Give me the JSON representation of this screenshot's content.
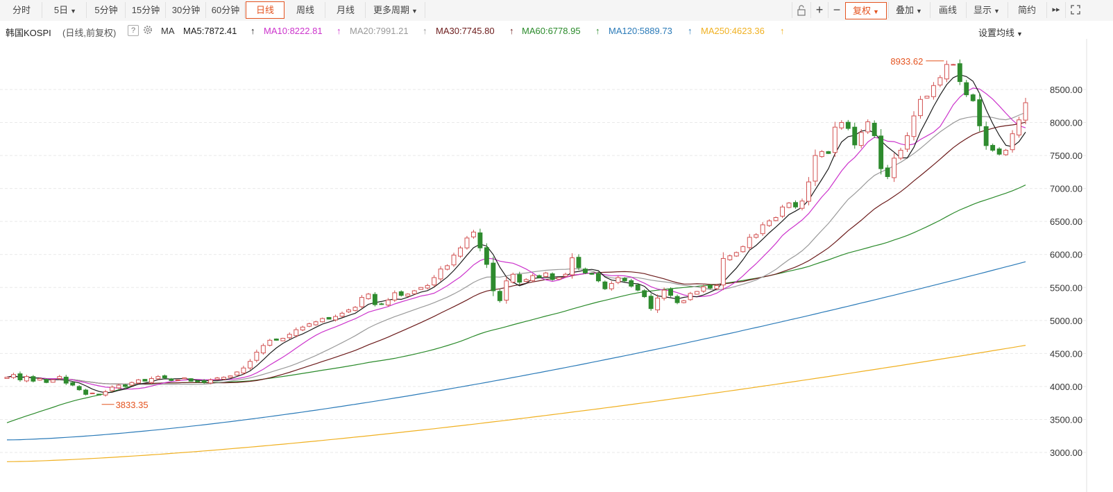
{
  "toolbar": {
    "left_tabs": [
      "分时",
      "5日",
      "5分钟",
      "15分钟",
      "30分钟",
      "60分钟",
      "日线",
      "周线",
      "月线",
      "更多周期"
    ],
    "active_tab": "日线",
    "right_tools": {
      "add": "+",
      "minus": "−",
      "fuquan": "复权",
      "overlay": "叠加",
      "draw": "画线",
      "display": "显示",
      "simple": "简约",
      "next": "▸▸"
    }
  },
  "legend": {
    "title": "韩国KOSPI",
    "subtitle": "(日线,前复权)",
    "help": "?",
    "ma_label": "MA",
    "ma5": "MA5:7872.41",
    "ma10": "MA10:8222.81",
    "ma20": "MA20:7991.21",
    "ma30": "MA30:7745.80",
    "ma60": "MA60:6778.95",
    "ma120": "MA120:5889.73",
    "ma250": "MA250:4623.36",
    "arrow": "↑",
    "settings": "设置均线"
  },
  "colors": {
    "up": "#d25050",
    "down": "#2e8b2e",
    "ma5": "#1a1a1a",
    "ma10": "#cc33cc",
    "ma20": "#999999",
    "ma30": "#6b1a1a",
    "ma60": "#2a8a2a",
    "ma120": "#2a7ab8",
    "ma250": "#f0b020",
    "accent": "#e4531f"
  },
  "chart_data": {
    "type": "candlestick",
    "title": "韩国KOSPI",
    "y_ticks": [
      "8500.00",
      "8000.00",
      "7500.00",
      "7000.00",
      "6500.00",
      "6000.00",
      "5500.00",
      "5000.00",
      "4500.00",
      "4000.00",
      "3500.00",
      "3000.00"
    ],
    "ylim": [
      2750,
      9200
    ],
    "grid": true,
    "annotations": {
      "max_label": "8933.62",
      "min_label": "3833.35",
      "max_value": 8933.62,
      "min_value": 3833.35
    },
    "closes": [
      4140,
      4180,
      4100,
      4150,
      4080,
      4120,
      4060,
      4100,
      4150,
      4050,
      4020,
      3950,
      3880,
      3900,
      3870,
      3920,
      3990,
      4020,
      4000,
      4060,
      4100,
      4080,
      4120,
      4150,
      4130,
      4090,
      4100,
      4130,
      4080,
      4070,
      4060,
      4100,
      4130,
      4140,
      4160,
      4220,
      4280,
      4380,
      4520,
      4620,
      4700,
      4700,
      4730,
      4790,
      4860,
      4900,
      4950,
      4980,
      5030,
      5020,
      5060,
      5110,
      5160,
      5200,
      5350,
      5400,
      5240,
      5250,
      5310,
      5420,
      5380,
      5400,
      5450,
      5500,
      5530,
      5650,
      5780,
      5830,
      5990,
      6100,
      6250,
      6340,
      6100,
      5850,
      5450,
      5300,
      5600,
      5700,
      5580,
      5620,
      5680,
      5650,
      5720,
      5620,
      5650,
      5700,
      5950,
      5800,
      5720,
      5700,
      5600,
      5480,
      5560,
      5650,
      5600,
      5520,
      5460,
      5360,
      5180,
      5340,
      5460,
      5380,
      5270,
      5300,
      5410,
      5440,
      5510,
      5490,
      5530,
      5940,
      5980,
      6030,
      6120,
      6260,
      6300,
      6450,
      6510,
      6560,
      6720,
      6780,
      6720,
      6810,
      7100,
      7500,
      7560,
      7530,
      7930,
      8000,
      7910,
      7660,
      7850,
      8010,
      7800,
      7300,
      7180,
      7460,
      7580,
      7800,
      8100,
      8350,
      8400,
      8560,
      8680,
      8880,
      8880,
      8620,
      8420,
      8330,
      7950,
      7650,
      7580,
      7520,
      7580,
      7830,
      8040,
      8300
    ],
    "ma_last": {
      "ma5": 7872.41,
      "ma10": 8222.81,
      "ma20": 7991.21,
      "ma30": 7745.8,
      "ma60": 6778.95,
      "ma120": 5889.73,
      "ma250": 4623.36
    }
  }
}
